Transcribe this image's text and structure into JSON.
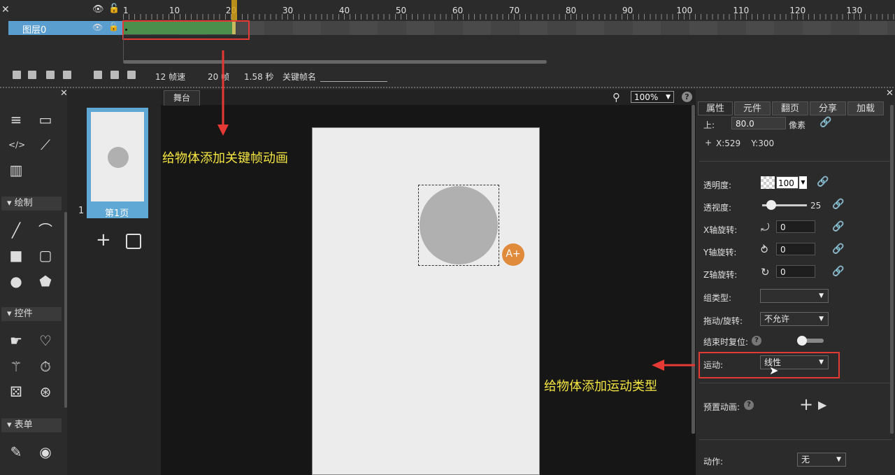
{
  "timeline": {
    "close_glyph": "✕",
    "ruler_labels": [
      "1",
      "10",
      "20",
      "30",
      "40",
      "50",
      "60",
      "70",
      "80",
      "90",
      "100",
      "110",
      "120",
      "130"
    ],
    "layer_name": "图层0",
    "fps_label": "12 帧速",
    "frames_label": "20 帧",
    "duration_label": "1.58 秒",
    "keyframe_name_label": "关键帧名"
  },
  "toolbar": {
    "sections": {
      "draw": "绘制",
      "widgets": "控件",
      "form": "表单"
    }
  },
  "pages": {
    "page_number": "1",
    "page_label": "第1页"
  },
  "stage": {
    "tab_label": "舞台",
    "zoom": "100%",
    "help_glyph": "?"
  },
  "annotations": {
    "keyframe_note": "给物体添加关键帧动画",
    "motion_note": "给物体添加运动类型"
  },
  "props": {
    "tabs": [
      "属性",
      "元件",
      "翻页",
      "分享",
      "加载"
    ],
    "top_label": "上:",
    "top_value": "80.0",
    "unit": "像素",
    "coords": "X:529    Y:300",
    "opacity_label": "透明度:",
    "opacity_value": "100",
    "perspective_label": "透视度:",
    "perspective_value": "25",
    "perspective_level": 0.2,
    "xrot_label": "X轴旋转:",
    "xrot_value": "0",
    "yrot_label": "Y轴旋转:",
    "yrot_value": "0",
    "zrot_label": "Z轴旋转:",
    "zrot_value": "0",
    "group_type_label": "组类型:",
    "group_type_value": "",
    "drag_rotate_label": "拖动/旋转:",
    "drag_rotate_value": "不允许",
    "reset_label": "结束时复位:",
    "motion_label": "运动:",
    "motion_value": "线性",
    "preset_anim_label": "预置动画:",
    "action_label": "动作:",
    "action_value": "无"
  }
}
